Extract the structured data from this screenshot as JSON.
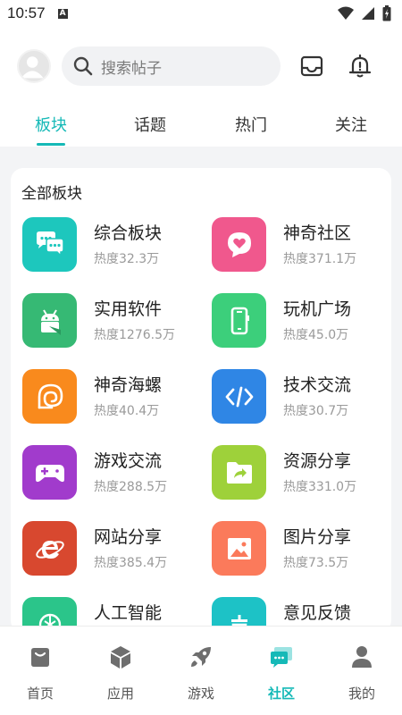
{
  "status_bar": {
    "time": "10:57",
    "notif_badge": "A"
  },
  "search": {
    "placeholder": "搜索帖子"
  },
  "tabs": [
    {
      "label": "板块",
      "active": true
    },
    {
      "label": "话题",
      "active": false
    },
    {
      "label": "热门",
      "active": false
    },
    {
      "label": "关注",
      "active": false
    }
  ],
  "section": {
    "title": "全部板块"
  },
  "boards": [
    {
      "name": "综合板块",
      "heat": "热度32.3万",
      "color": "#1dc7bd",
      "icon": "chat-bubbles-icon"
    },
    {
      "name": "神奇社区",
      "heat": "热度371.1万",
      "color": "#f0588d",
      "icon": "heart-bubble-icon"
    },
    {
      "name": "实用软件",
      "heat": "热度1276.5万",
      "color": "#36b974",
      "icon": "android-icon"
    },
    {
      "name": "玩机广场",
      "heat": "热度45.0万",
      "color": "#3ccf7b",
      "icon": "phone-icon"
    },
    {
      "name": "神奇海螺",
      "heat": "热度40.4万",
      "color": "#f98a1d",
      "icon": "conch-icon"
    },
    {
      "name": "技术交流",
      "heat": "热度30.7万",
      "color": "#2f86e5",
      "icon": "code-icon"
    },
    {
      "name": "游戏交流",
      "heat": "热度288.5万",
      "color": "#a13bcc",
      "icon": "gamepad-icon"
    },
    {
      "name": "资源分享",
      "heat": "热度331.0万",
      "color": "#9ed13a",
      "icon": "share-folder-icon"
    },
    {
      "name": "网站分享",
      "heat": "热度385.4万",
      "color": "#d8482f",
      "icon": "browser-icon"
    },
    {
      "name": "图片分享",
      "heat": "热度73.5万",
      "color": "#fb7a5b",
      "icon": "image-icon"
    },
    {
      "name": "人工智能",
      "heat": "",
      "color": "#2bc58a",
      "icon": "ai-icon"
    },
    {
      "name": "意见反馈",
      "heat": "",
      "color": "#1dc2c6",
      "icon": "feedback-icon"
    }
  ],
  "bottom_nav": [
    {
      "label": "首页",
      "icon": "home-bag-icon",
      "active": false
    },
    {
      "label": "应用",
      "icon": "cube-icon",
      "active": false
    },
    {
      "label": "游戏",
      "icon": "rocket-icon",
      "active": false
    },
    {
      "label": "社区",
      "icon": "community-icon",
      "active": true
    },
    {
      "label": "我的",
      "icon": "user-icon",
      "active": false
    }
  ],
  "colors": {
    "accent": "#15b9b7",
    "nav_icon": "#6e6e6e"
  }
}
